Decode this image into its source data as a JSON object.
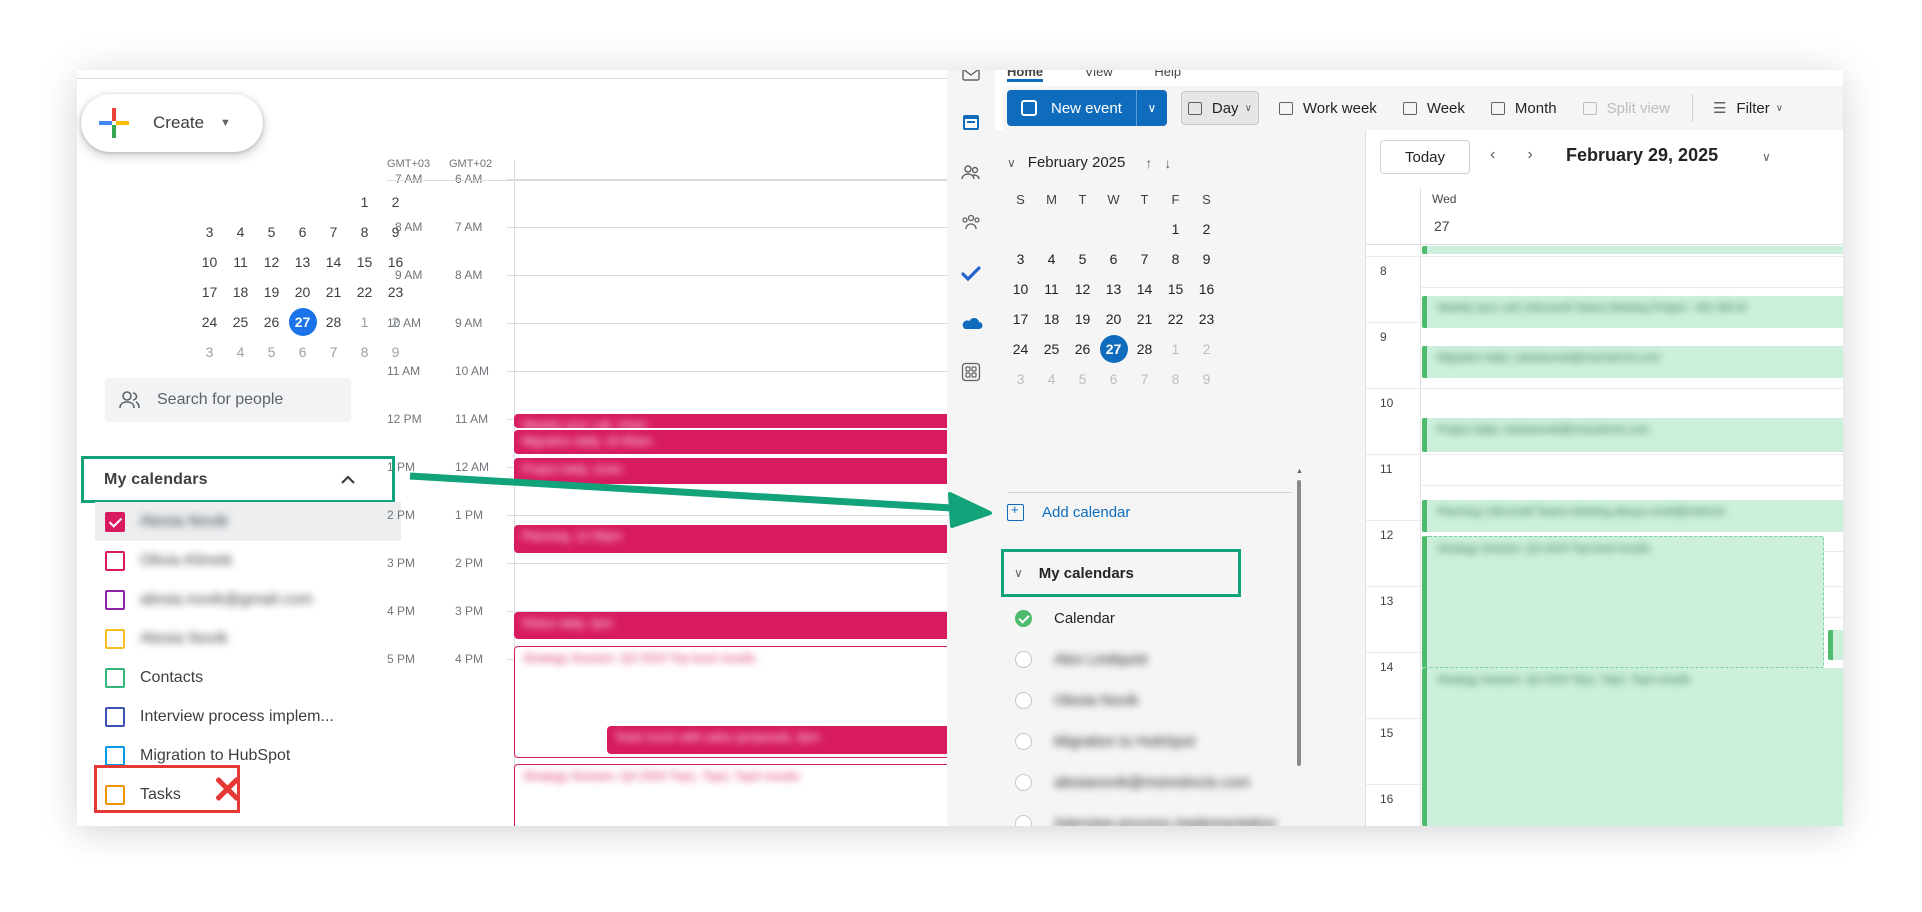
{
  "gcal": {
    "create_label": "Create",
    "tz_left": "GMT+03",
    "tz_right": "GMT+02",
    "mini_calendar": {
      "weeks": [
        [
          {
            "d": "",
            "m": false
          },
          {
            "d": "",
            "m": false
          },
          {
            "d": "",
            "m": false
          },
          {
            "d": "",
            "m": false
          },
          {
            "d": "",
            "m": false
          },
          {
            "d": "1",
            "m": false
          },
          {
            "d": "2",
            "m": false
          }
        ],
        [
          {
            "d": "3",
            "m": false
          },
          {
            "d": "4",
            "m": false
          },
          {
            "d": "5",
            "m": false
          },
          {
            "d": "6",
            "m": false
          },
          {
            "d": "7",
            "m": false
          },
          {
            "d": "8",
            "m": false
          },
          {
            "d": "9",
            "m": false
          }
        ],
        [
          {
            "d": "10",
            "m": false
          },
          {
            "d": "11",
            "m": false
          },
          {
            "d": "12",
            "m": false
          },
          {
            "d": "13",
            "m": false
          },
          {
            "d": "14",
            "m": false
          },
          {
            "d": "15",
            "m": false
          },
          {
            "d": "16",
            "m": false
          }
        ],
        [
          {
            "d": "17",
            "m": false
          },
          {
            "d": "18",
            "m": false
          },
          {
            "d": "19",
            "m": false
          },
          {
            "d": "20",
            "m": false
          },
          {
            "d": "21",
            "m": false
          },
          {
            "d": "22",
            "m": false
          },
          {
            "d": "23",
            "m": false
          }
        ],
        [
          {
            "d": "24",
            "m": false
          },
          {
            "d": "25",
            "m": false
          },
          {
            "d": "26",
            "m": false
          },
          {
            "d": "27",
            "m": false,
            "today": true
          },
          {
            "d": "28",
            "m": false
          },
          {
            "d": "1",
            "m": true
          },
          {
            "d": "2",
            "m": true
          }
        ],
        [
          {
            "d": "3",
            "m": true
          },
          {
            "d": "4",
            "m": true
          },
          {
            "d": "5",
            "m": true
          },
          {
            "d": "6",
            "m": true
          },
          {
            "d": "7",
            "m": true
          },
          {
            "d": "8",
            "m": true
          },
          {
            "d": "9",
            "m": true
          }
        ]
      ]
    },
    "search_people": "Search for people",
    "my_calendars_label": "My calendars",
    "calendars": [
      {
        "name": "Alesia Novik",
        "color": "#d81b60",
        "checked": true,
        "blurred": true
      },
      {
        "name": "Olivia Klimek",
        "color": "#d81b60",
        "checked": false,
        "blurred": true
      },
      {
        "name": "alesia.novik@gmail.com",
        "color": "#8e24aa",
        "checked": false,
        "blurred": true
      },
      {
        "name": "Alesia Novik",
        "color": "#f6bf26",
        "checked": false,
        "blurred": true
      },
      {
        "name": "Contacts",
        "color": "#33b679",
        "checked": false,
        "blurred": false
      },
      {
        "name": "Interview process implem...",
        "color": "#3f51b5",
        "checked": false,
        "blurred": false
      },
      {
        "name": "Migration to HubSpot",
        "color": "#039be5",
        "checked": false,
        "blurred": false
      },
      {
        "name": "Tasks",
        "color": "#f09300",
        "checked": false,
        "blurred": false
      }
    ],
    "times_left": [
      "7 AM",
      "8 AM",
      "9 AM",
      "10 AM",
      "11 AM",
      "12 PM",
      "1 PM",
      "2 PM",
      "3 PM",
      "4 PM",
      "5 PM"
    ],
    "times_right": [
      "6 AM",
      "7 AM",
      "8 AM",
      "9 AM",
      "10 AM",
      "11 AM",
      "12 AM",
      "1 PM",
      "2 PM",
      "3 PM",
      "4 PM"
    ],
    "events": [
      {
        "text": "Weekly sync call, 10am"
      },
      {
        "text": "Migration daily, 10:45am"
      },
      {
        "text": "Project daily, 11am"
      },
      {
        "text": "Planning, 12:30pm"
      },
      {
        "text": "Status daily, 2pm"
      },
      {
        "text": "Strategy Session: Q4 2024 Top level results"
      },
      {
        "text": "Team lunch with sales (proposal), 4pm"
      },
      {
        "text": "Strategy Session: Q4 2024 Top1, Top2, Top3 results"
      }
    ]
  },
  "outlook": {
    "top_tabs": [
      "Home",
      "View",
      "Help"
    ],
    "new_event_label": "New event",
    "view_buttons": [
      "Day",
      "Work week",
      "Week",
      "Month",
      "Split view",
      "Filter"
    ],
    "mini_month_title": "February 2025",
    "weekday_headers": [
      "S",
      "M",
      "T",
      "W",
      "T",
      "F",
      "S"
    ],
    "mini_calendar": {
      "weeks": [
        [
          {
            "d": "",
            "m": false
          },
          {
            "d": "",
            "m": false
          },
          {
            "d": "",
            "m": false
          },
          {
            "d": "",
            "m": false
          },
          {
            "d": "",
            "m": false
          },
          {
            "d": "1",
            "m": false
          },
          {
            "d": "2",
            "m": false
          }
        ],
        [
          {
            "d": "3",
            "m": false
          },
          {
            "d": "4",
            "m": false
          },
          {
            "d": "5",
            "m": false
          },
          {
            "d": "6",
            "m": false
          },
          {
            "d": "7",
            "m": false
          },
          {
            "d": "8",
            "m": false
          },
          {
            "d": "9",
            "m": false
          }
        ],
        [
          {
            "d": "10",
            "m": false
          },
          {
            "d": "11",
            "m": false
          },
          {
            "d": "12",
            "m": false
          },
          {
            "d": "13",
            "m": false
          },
          {
            "d": "14",
            "m": false
          },
          {
            "d": "15",
            "m": false
          },
          {
            "d": "16",
            "m": false
          }
        ],
        [
          {
            "d": "17",
            "m": false
          },
          {
            "d": "18",
            "m": false
          },
          {
            "d": "19",
            "m": false
          },
          {
            "d": "20",
            "m": false
          },
          {
            "d": "21",
            "m": false
          },
          {
            "d": "22",
            "m": false
          },
          {
            "d": "23",
            "m": false
          }
        ],
        [
          {
            "d": "24",
            "m": false
          },
          {
            "d": "25",
            "m": false
          },
          {
            "d": "26",
            "m": false
          },
          {
            "d": "27",
            "m": false,
            "today": true
          },
          {
            "d": "28",
            "m": false
          },
          {
            "d": "1",
            "m": true
          },
          {
            "d": "2",
            "m": true
          }
        ],
        [
          {
            "d": "3",
            "m": true
          },
          {
            "d": "4",
            "m": true
          },
          {
            "d": "5",
            "m": true
          },
          {
            "d": "6",
            "m": true
          },
          {
            "d": "7",
            "m": true
          },
          {
            "d": "8",
            "m": true
          },
          {
            "d": "9",
            "m": true
          }
        ]
      ]
    },
    "add_calendar_label": "Add calendar",
    "my_calendars_label": "My calendars",
    "calendars": [
      {
        "name": "Calendar",
        "on": true,
        "blurred": false
      },
      {
        "name": "Alex Lindquist",
        "on": false,
        "blurred": true
      },
      {
        "name": "Olesia Novik",
        "on": false,
        "blurred": true
      },
      {
        "name": "Migration to HubSpot",
        "on": false,
        "blurred": true
      },
      {
        "name": "alesianovik@msinstincts.com",
        "on": false,
        "blurred": true
      },
      {
        "name": "Interview process implementation",
        "on": false,
        "blurred": true
      },
      {
        "name": "alesianovik@gmail.com",
        "on": false,
        "blurred": true
      }
    ],
    "today_label": "Today",
    "day_title": "February 29, 2025",
    "day_weekday": "Wed",
    "day_number": "27",
    "hours": [
      "8",
      "9",
      "10",
      "11",
      "12",
      "13",
      "14",
      "15",
      "16"
    ],
    "events": [
      {
        "text": "Weekly sync call | Microsoft Teams Meeting Project - MS 365 M"
      },
      {
        "text": "Migration daily | alesianovik@msinstincts.com"
      },
      {
        "text": "Project daily | alesianovik@msinstincts.com"
      },
      {
        "text": "Planning | Microsoft Teams Meeting alesya.novik@instincts"
      },
      {
        "text": "Strategy Session: Q4 2024 Top level results"
      },
      {
        "text": "Strategy Session: Q4 2024 Top1, Top2, Top3 results"
      }
    ]
  },
  "colors": {
    "accent_google": "#1a73e8",
    "accent_outlook": "#0f6cbd",
    "highlight_green": "#12a37b",
    "highlight_red": "#e53935",
    "event_pink": "#d81b60",
    "event_green": "#ccf0dc"
  }
}
